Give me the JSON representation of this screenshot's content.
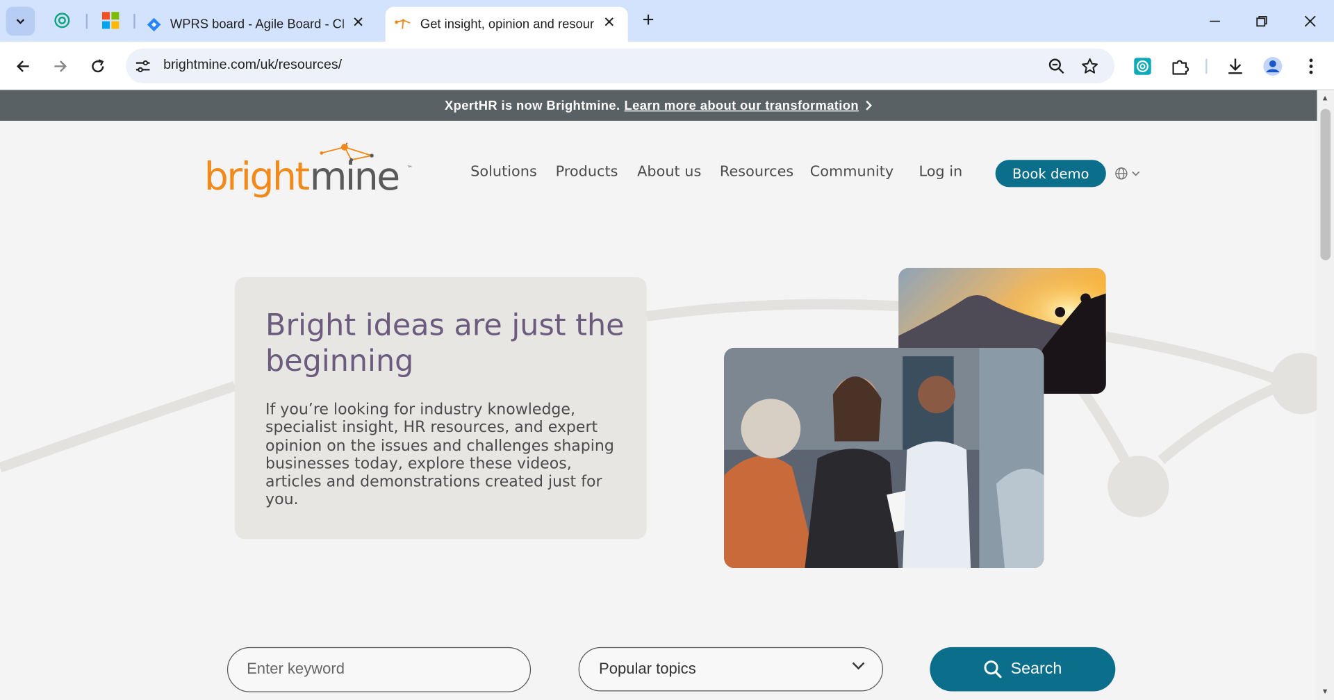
{
  "browser": {
    "tabs": [
      {
        "title": "WPRS board - Agile Board - CE",
        "icon": "jira-icon"
      },
      {
        "title": "Get insight, opinion and resour",
        "icon": "brightmine-icon"
      }
    ],
    "url": "brightmine.com/uk/resources/"
  },
  "banner": {
    "text": "XpertHR is now Brightmine.",
    "link": "Learn more about our transformation"
  },
  "header": {
    "logo_part1": "bright",
    "logo_part2": "mine",
    "logo_tm": "™",
    "nav": [
      "Solutions",
      "Products",
      "About us",
      "Resources",
      "Community"
    ],
    "login": "Log in",
    "demo": "Book demo"
  },
  "hero": {
    "title": "Bright ideas are just the beginning",
    "text": "If you’re looking for industry knowledge, specialist insight, HR resources, and expert opinion on the issues and challenges shaping businesses today, explore these videos, articles and demonstrations created just for you."
  },
  "search": {
    "placeholder": "Enter keyword",
    "topics": "Popular topics",
    "button": "Search"
  },
  "colors": {
    "brand_teal": "#0b6e8b",
    "brand_orange": "#f08a1c",
    "hero_purple": "#6b5b7e"
  }
}
